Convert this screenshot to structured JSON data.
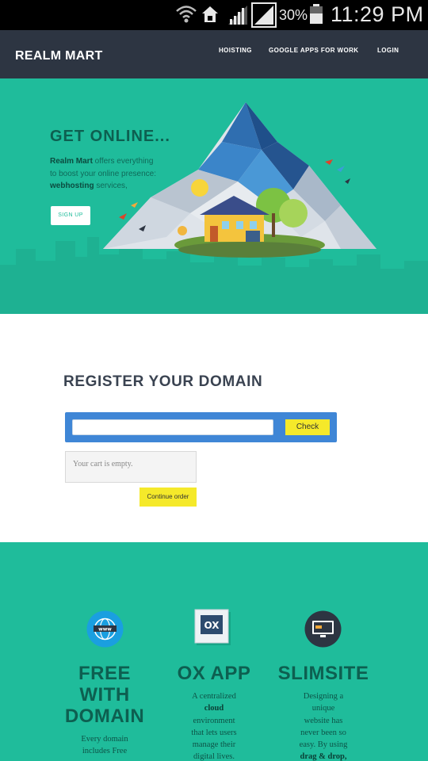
{
  "status_bar": {
    "battery_percent": "30%",
    "time": "11:29 PM",
    "icons": [
      "wifi-icon",
      "home-icon",
      "signal-icon",
      "signal-icon",
      "battery-icon"
    ]
  },
  "nav": {
    "brand": "REALM MART",
    "links": [
      "HOISTING",
      "GOOGLE APPS FOR WORK",
      "LOGIN"
    ]
  },
  "hero": {
    "title": "GET ONLINE...",
    "text_brand": "Realm Mart",
    "text_line1": " offers everything",
    "text_line2": "to boost your online presence:",
    "text_bold": "webhosting",
    "text_tail": " services,",
    "signup_label": "SIGN UP"
  },
  "register": {
    "title": "REGISTER YOUR DOMAIN",
    "domain_input_value": "",
    "check_label": "Check",
    "cart_text": "Your cart is empty.",
    "continue_label": "Continue order"
  },
  "features": [
    {
      "icon": "www-globe-icon",
      "title_lines": [
        "FREE",
        "WITH",
        "DOMAIN"
      ],
      "text_lines": [
        "Every domain",
        "includes Free"
      ]
    },
    {
      "icon": "ox-app-icon",
      "title_lines": [
        "OX APP"
      ],
      "text_lines": [
        "A centralized",
        "cloud",
        "environment",
        "that lets users",
        "manage their",
        "digital lives."
      ]
    },
    {
      "icon": "monitor-icon",
      "title_lines": [
        "SLIMSITE"
      ],
      "text_lines": [
        "Designing a",
        "unique",
        "website has",
        "never been so",
        "easy. By using",
        "drag & drop,"
      ]
    }
  ],
  "colors": {
    "nav_bg": "#2d3542",
    "teal": "#1fbc9b",
    "dark_teal": "#0d5f50",
    "search_blue": "#3f86d6",
    "button_yellow": "#f5e92a"
  }
}
